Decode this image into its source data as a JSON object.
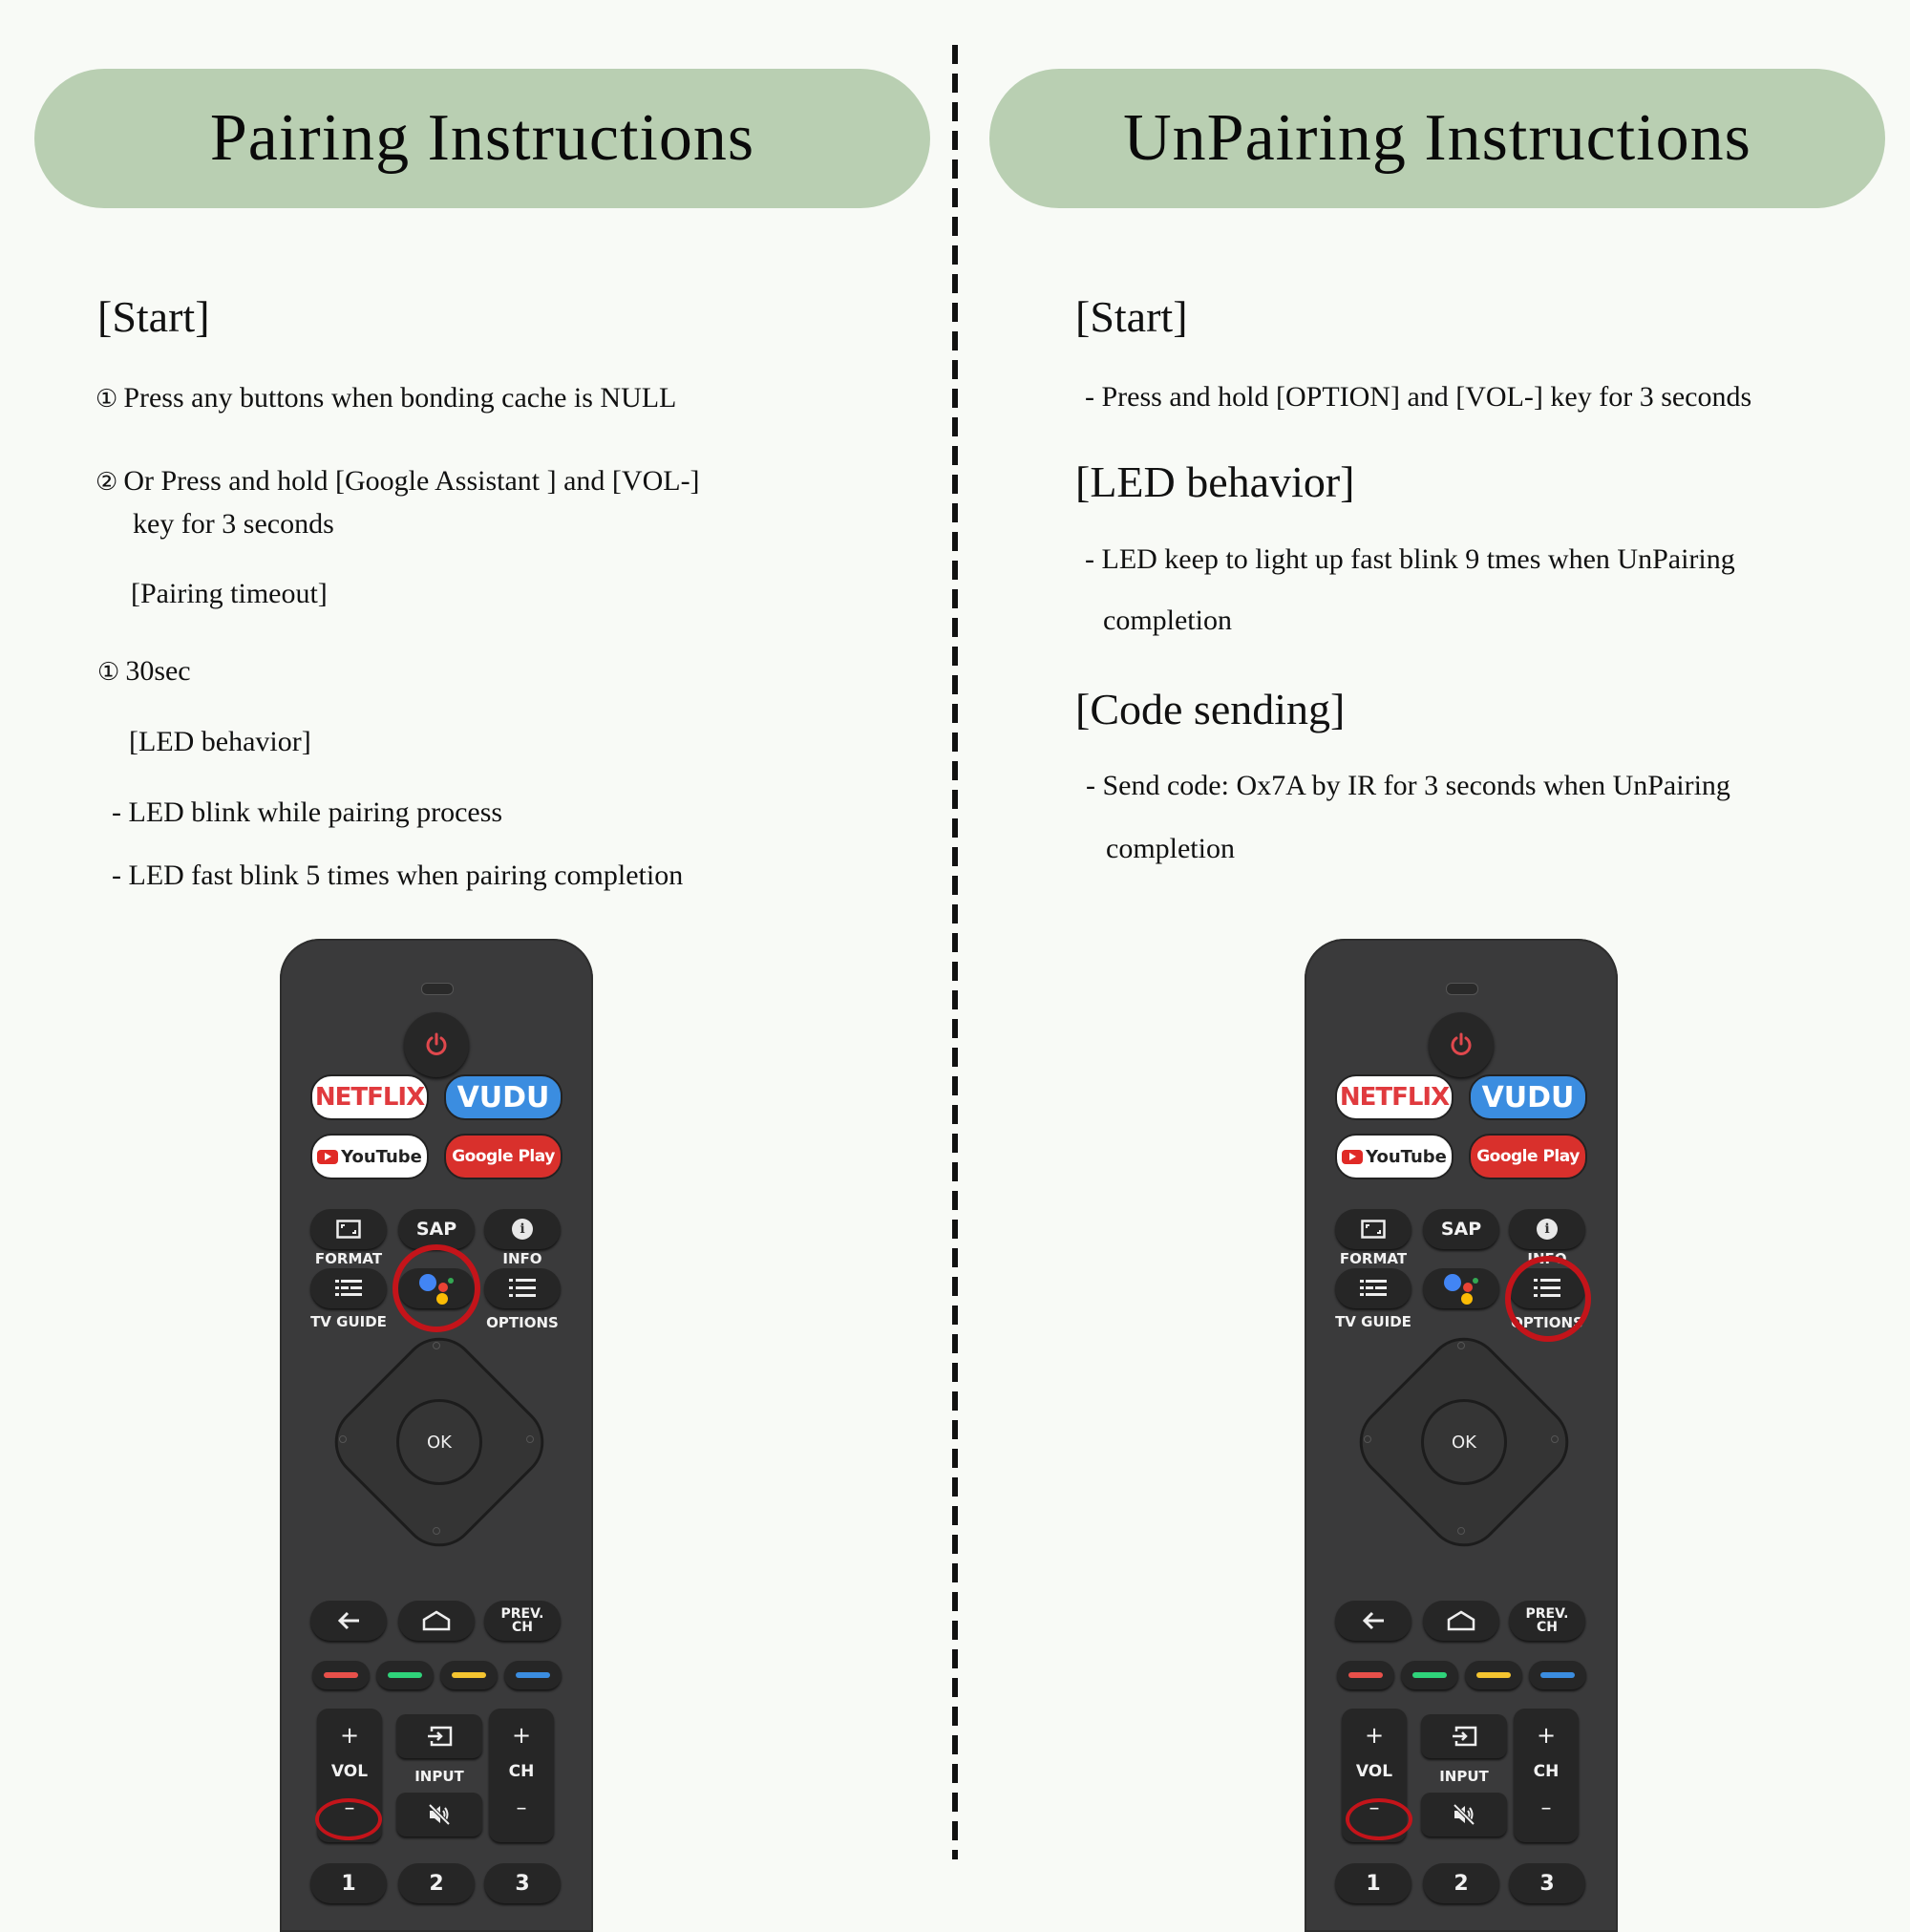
{
  "colors": {
    "background": "#f8faf6",
    "header_pill": "#b9cfb2",
    "text": "#111111",
    "highlight": "#c4141a",
    "remote_body": "#3a3a3b"
  },
  "pairing": {
    "title": "Pairing Instructions",
    "start_heading": "[Start]",
    "step1_marker": "①",
    "step1_text": "Press any buttons when bonding cache is NULL",
    "step2_marker": "②",
    "step2_line1": "Or Press and hold [Google Assistant ] and [VOL-]",
    "step2_line2": "key for 3 seconds",
    "timeout_heading": "[Pairing timeout]",
    "timeout_marker": "①",
    "timeout_value": "30sec",
    "led_heading": "[LED behavior]",
    "led_items": [
      "- LED blink while pairing process",
      "- LED fast blink 5 times when pairing completion"
    ],
    "highlighted_keys": [
      "google-assistant",
      "vol-minus"
    ]
  },
  "unpairing": {
    "title": "UnPairing Instructions",
    "start_heading": "[Start]",
    "start_text": "- Press and hold [OPTION] and [VOL-] key for 3 seconds",
    "led_heading": "[LED behavior]",
    "led_line1": "- LED keep to light up fast blink 9 tmes when UnPairing",
    "led_line2": "completion",
    "code_heading": "[Code sending]",
    "code_line1": "- Send code: Ox7A by IR for 3 seconds when UnPairing",
    "code_line2": "completion",
    "highlighted_keys": [
      "options",
      "vol-minus"
    ]
  },
  "remote": {
    "apps": {
      "netflix": "NETFLIX",
      "vudu": "VUDU",
      "youtube": "YouTube",
      "google_play": "Google Play"
    },
    "sap": "SAP",
    "format": "FORMAT",
    "info": "INFO",
    "tv_guide": "TV GUIDE",
    "options": "OPTIONS",
    "ok": "OK",
    "prev_ch_line1": "PREV.",
    "prev_ch_line2": "CH",
    "vol": "VOL",
    "ch": "CH",
    "input": "INPUT",
    "plus": "+",
    "minus": "–",
    "numbers": [
      "1",
      "2",
      "3"
    ],
    "color_keys": [
      "#e8504a",
      "#2fd37a",
      "#f4c430",
      "#3b8de0"
    ]
  }
}
